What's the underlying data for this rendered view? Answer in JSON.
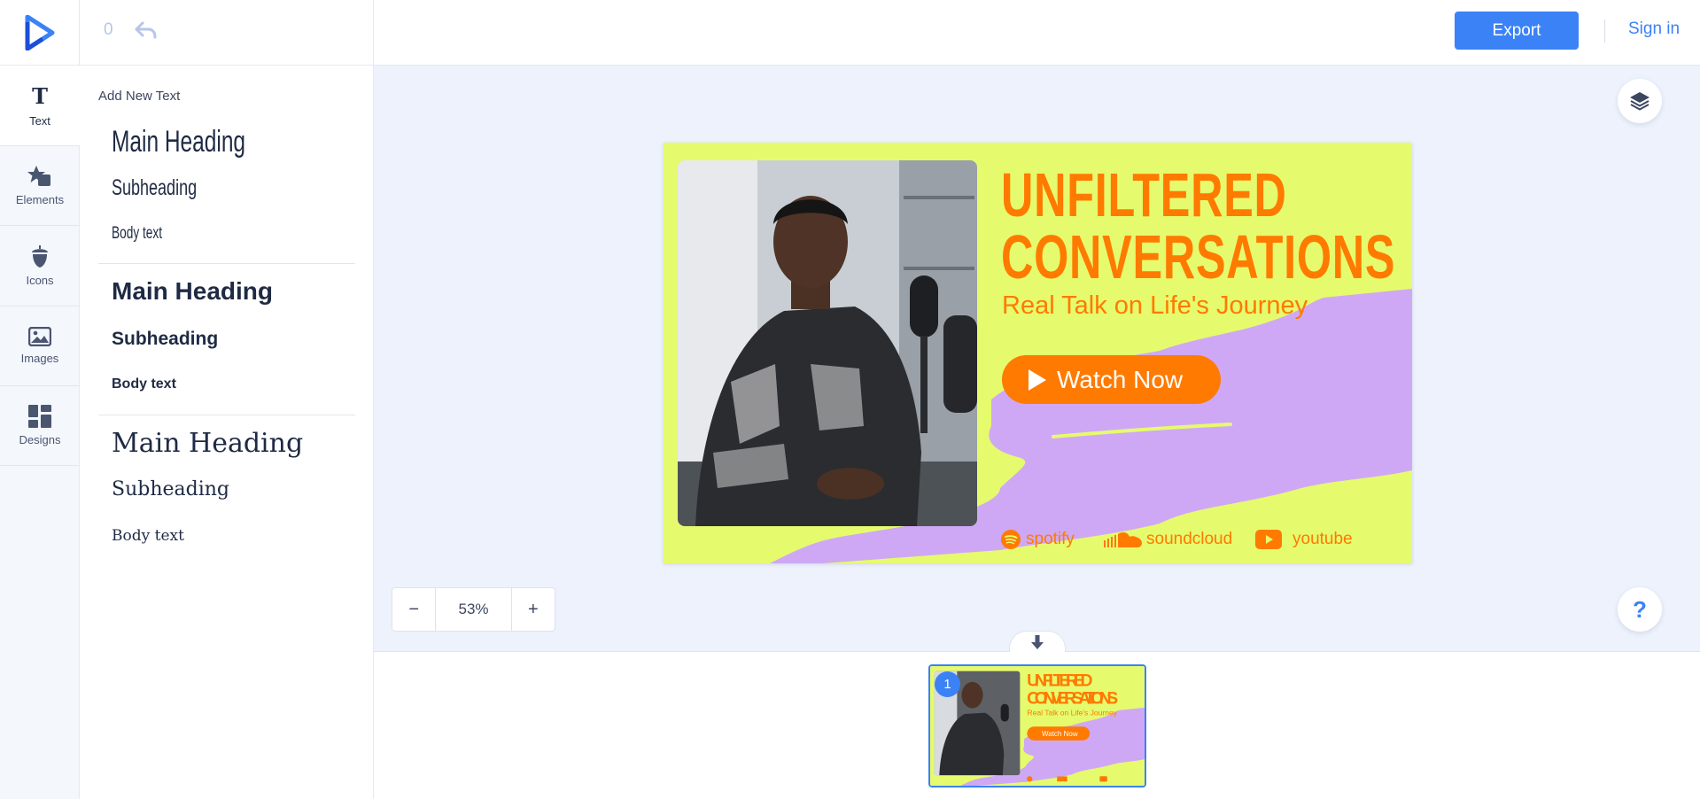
{
  "app": {
    "undo_count": "0",
    "export_label": "Export",
    "signin_label": "Sign in"
  },
  "rail": {
    "items": [
      {
        "label": "Text",
        "icon": "text-icon"
      },
      {
        "label": "Elements",
        "icon": "shapes-icon"
      },
      {
        "label": "Icons",
        "icon": "acorn-icon"
      },
      {
        "label": "Images",
        "icon": "image-icon"
      },
      {
        "label": "Designs",
        "icon": "grid-icon"
      }
    ]
  },
  "text_panel": {
    "title": "Add New Text",
    "groups": [
      {
        "heading": "Main Heading",
        "subheading": "Subheading",
        "body": "Body text"
      },
      {
        "heading": "Main Heading",
        "subheading": "Subheading",
        "body": "Body text"
      },
      {
        "heading": "Main Heading",
        "subheading": "Subheading",
        "body": "Body text"
      }
    ]
  },
  "zoom": {
    "minus": "−",
    "value": "53%",
    "plus": "+"
  },
  "help_label": "?",
  "design": {
    "title_line1": "UNFILTERED",
    "title_line2": "CONVERSATIONS",
    "subtitle": "Real Talk on Life's Journey",
    "button_label": "Watch Now",
    "platforms": [
      "spotify",
      "soundcloud",
      "youtube"
    ],
    "colors": {
      "background": "#e6fa6e",
      "accent": "#ff7a00",
      "brush": "#cfa8f5"
    }
  },
  "pages": {
    "current_page": "1"
  },
  "colors": {
    "primary": "#3b82f6",
    "workspace": "#edf2fc"
  }
}
